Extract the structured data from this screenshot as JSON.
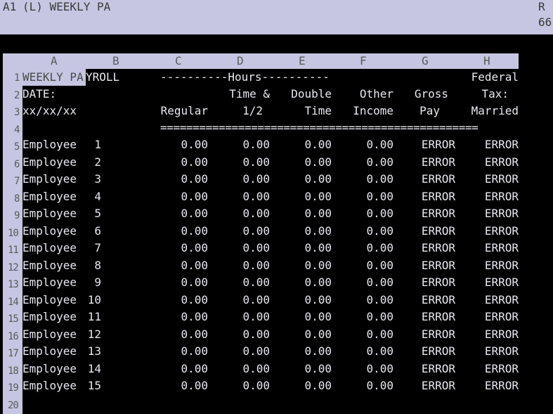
{
  "status": {
    "cell_ref": "A1",
    "cell_contents": "(L) WEEKLY PA",
    "mode_char": "R",
    "memory": "66"
  },
  "columns": [
    "A",
    "B",
    "C",
    "D",
    "E",
    "F",
    "G",
    "H"
  ],
  "header_rows": {
    "r1": {
      "a": "WEEKLY PA",
      "b": "YROLL",
      "hours_bar": "----------Hours----------",
      "h": "Federal"
    },
    "r2": {
      "a": "DATE:",
      "d": "Time &",
      "e": "Double",
      "f": "Other",
      "g": "Gross",
      "h": "Tax:"
    },
    "r3": {
      "a": "xx/xx/xx",
      "c": "Regular",
      "d": "1/2",
      "e": "Time",
      "f": "Income",
      "g": "Pay",
      "h": "Married"
    },
    "r4": {
      "separator": "================================================="
    }
  },
  "employees": [
    {
      "name": "Employee",
      "num": "1",
      "regular": "0.00",
      "time_half": "0.00",
      "double": "0.00",
      "other": "0.00",
      "gross": "ERROR",
      "fed": "ERROR"
    },
    {
      "name": "Employee",
      "num": "2",
      "regular": "0.00",
      "time_half": "0.00",
      "double": "0.00",
      "other": "0.00",
      "gross": "ERROR",
      "fed": "ERROR"
    },
    {
      "name": "Employee",
      "num": "3",
      "regular": "0.00",
      "time_half": "0.00",
      "double": "0.00",
      "other": "0.00",
      "gross": "ERROR",
      "fed": "ERROR"
    },
    {
      "name": "Employee",
      "num": "4",
      "regular": "0.00",
      "time_half": "0.00",
      "double": "0.00",
      "other": "0.00",
      "gross": "ERROR",
      "fed": "ERROR"
    },
    {
      "name": "Employee",
      "num": "5",
      "regular": "0.00",
      "time_half": "0.00",
      "double": "0.00",
      "other": "0.00",
      "gross": "ERROR",
      "fed": "ERROR"
    },
    {
      "name": "Employee",
      "num": "6",
      "regular": "0.00",
      "time_half": "0.00",
      "double": "0.00",
      "other": "0.00",
      "gross": "ERROR",
      "fed": "ERROR"
    },
    {
      "name": "Employee",
      "num": "7",
      "regular": "0.00",
      "time_half": "0.00",
      "double": "0.00",
      "other": "0.00",
      "gross": "ERROR",
      "fed": "ERROR"
    },
    {
      "name": "Employee",
      "num": "8",
      "regular": "0.00",
      "time_half": "0.00",
      "double": "0.00",
      "other": "0.00",
      "gross": "ERROR",
      "fed": "ERROR"
    },
    {
      "name": "Employee",
      "num": "9",
      "regular": "0.00",
      "time_half": "0.00",
      "double": "0.00",
      "other": "0.00",
      "gross": "ERROR",
      "fed": "ERROR"
    },
    {
      "name": "Employee",
      "num": "10",
      "regular": "0.00",
      "time_half": "0.00",
      "double": "0.00",
      "other": "0.00",
      "gross": "ERROR",
      "fed": "ERROR"
    },
    {
      "name": "Employee",
      "num": "11",
      "regular": "0.00",
      "time_half": "0.00",
      "double": "0.00",
      "other": "0.00",
      "gross": "ERROR",
      "fed": "ERROR"
    },
    {
      "name": "Employee",
      "num": "12",
      "regular": "0.00",
      "time_half": "0.00",
      "double": "0.00",
      "other": "0.00",
      "gross": "ERROR",
      "fed": "ERROR"
    },
    {
      "name": "Employee",
      "num": "13",
      "regular": "0.00",
      "time_half": "0.00",
      "double": "0.00",
      "other": "0.00",
      "gross": "ERROR",
      "fed": "ERROR"
    },
    {
      "name": "Employee",
      "num": "14",
      "regular": "0.00",
      "time_half": "0.00",
      "double": "0.00",
      "other": "0.00",
      "gross": "ERROR",
      "fed": "ERROR"
    },
    {
      "name": "Employee",
      "num": "15",
      "regular": "0.00",
      "time_half": "0.00",
      "double": "0.00",
      "other": "0.00",
      "gross": "ERROR",
      "fed": "ERROR"
    }
  ],
  "row_numbers": [
    "1",
    "2",
    "3",
    "4",
    "5",
    "6",
    "7",
    "8",
    "9",
    "10",
    "11",
    "12",
    "13",
    "14",
    "15",
    "16",
    "17",
    "18",
    "19",
    "20"
  ]
}
